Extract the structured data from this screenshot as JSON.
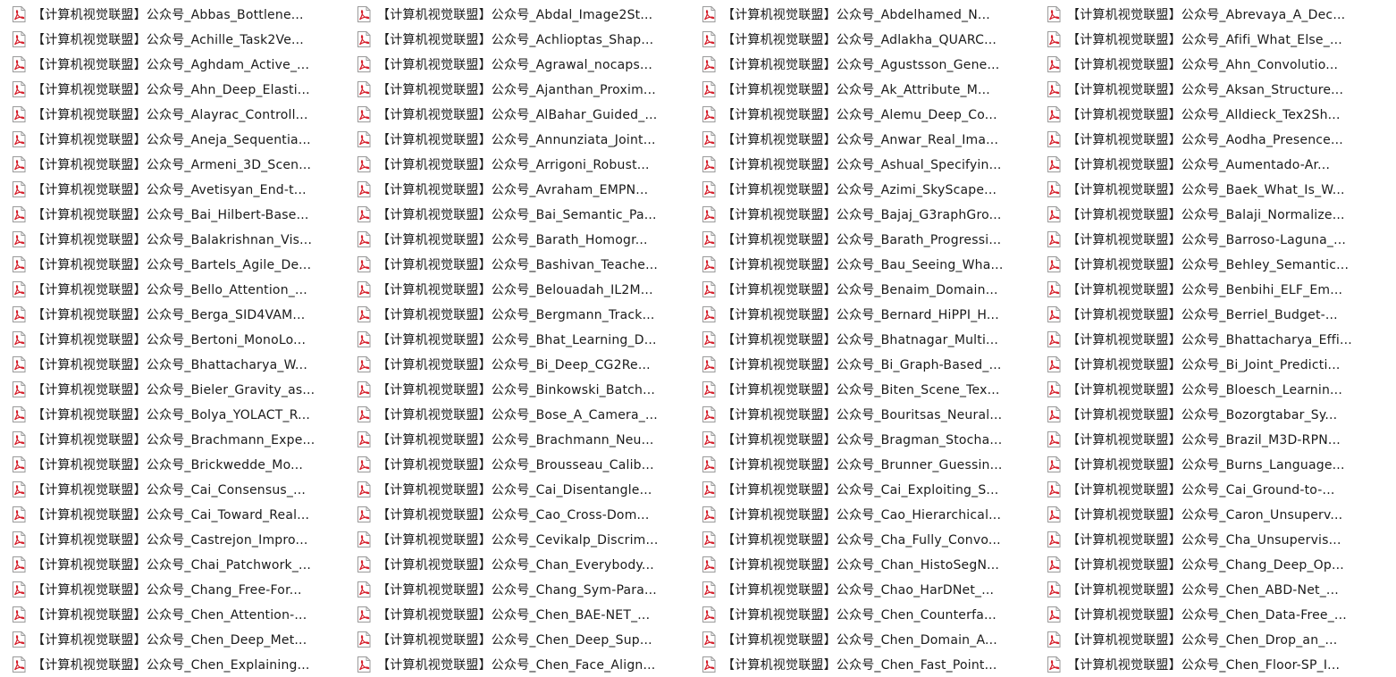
{
  "file_icon": "pdf-icon",
  "accent_color": "#d61e2a",
  "files": [
    [
      "【计算机视觉联盟】公众号_Abbas_Bottlene...",
      "【计算机视觉联盟】公众号_Abdal_Image2St...",
      "【计算机视觉联盟】公众号_Abdelhamed_N...",
      "【计算机视觉联盟】公众号_Abrevaya_A_Dec..."
    ],
    [
      "【计算机视觉联盟】公众号_Achille_Task2Ve...",
      "【计算机视觉联盟】公众号_Achlioptas_Shap...",
      "【计算机视觉联盟】公众号_Adlakha_QUARC...",
      "【计算机视觉联盟】公众号_Afifi_What_Else_..."
    ],
    [
      "【计算机视觉联盟】公众号_Aghdam_Active_...",
      "【计算机视觉联盟】公众号_Agrawal_nocaps...",
      "【计算机视觉联盟】公众号_Agustsson_Gene...",
      "【计算机视觉联盟】公众号_Ahn_Convolutio..."
    ],
    [
      "【计算机视觉联盟】公众号_Ahn_Deep_Elasti...",
      "【计算机视觉联盟】公众号_Ajanthan_Proxim...",
      "【计算机视觉联盟】公众号_Ak_Attribute_M...",
      "【计算机视觉联盟】公众号_Aksan_Structure..."
    ],
    [
      "【计算机视觉联盟】公众号_Alayrac_Controll...",
      "【计算机视觉联盟】公众号_AlBahar_Guided_...",
      "【计算机视觉联盟】公众号_Alemu_Deep_Co...",
      "【计算机视觉联盟】公众号_Alldieck_Tex2Sh..."
    ],
    [
      "【计算机视觉联盟】公众号_Aneja_Sequentia...",
      "【计算机视觉联盟】公众号_Annunziata_Joint...",
      "【计算机视觉联盟】公众号_Anwar_Real_Ima...",
      "【计算机视觉联盟】公众号_Aodha_Presence..."
    ],
    [
      "【计算机视觉联盟】公众号_Armeni_3D_Scen...",
      "【计算机视觉联盟】公众号_Arrigoni_Robust...",
      "【计算机视觉联盟】公众号_Ashual_Specifyin...",
      "【计算机视觉联盟】公众号_Aumentado-Ar..."
    ],
    [
      "【计算机视觉联盟】公众号_Avetisyan_End-t...",
      "【计算机视觉联盟】公众号_Avraham_EMPN...",
      "【计算机视觉联盟】公众号_Azimi_SkyScape...",
      "【计算机视觉联盟】公众号_Baek_What_Is_W..."
    ],
    [
      "【计算机视觉联盟】公众号_Bai_Hilbert-Base...",
      "【计算机视觉联盟】公众号_Bai_Semantic_Pa...",
      "【计算机视觉联盟】公众号_Bajaj_G3raphGro...",
      "【计算机视觉联盟】公众号_Balaji_Normalize..."
    ],
    [
      "【计算机视觉联盟】公众号_Balakrishnan_Vis...",
      "【计算机视觉联盟】公众号_Barath_Homogr...",
      "【计算机视觉联盟】公众号_Barath_Progressi...",
      "【计算机视觉联盟】公众号_Barroso-Laguna_..."
    ],
    [
      "【计算机视觉联盟】公众号_Bartels_Agile_De...",
      "【计算机视觉联盟】公众号_Bashivan_Teache...",
      "【计算机视觉联盟】公众号_Bau_Seeing_Wha...",
      "【计算机视觉联盟】公众号_Behley_Semantic..."
    ],
    [
      "【计算机视觉联盟】公众号_Bello_Attention_...",
      "【计算机视觉联盟】公众号_Belouadah_IL2M...",
      "【计算机视觉联盟】公众号_Benaim_Domain...",
      "【计算机视觉联盟】公众号_Benbihi_ELF_Em..."
    ],
    [
      "【计算机视觉联盟】公众号_Berga_SID4VAM...",
      "【计算机视觉联盟】公众号_Bergmann_Track...",
      "【计算机视觉联盟】公众号_Bernard_HiPPI_H...",
      "【计算机视觉联盟】公众号_Berriel_Budget-..."
    ],
    [
      "【计算机视觉联盟】公众号_Bertoni_MonoLo...",
      "【计算机视觉联盟】公众号_Bhat_Learning_D...",
      "【计算机视觉联盟】公众号_Bhatnagar_Multi...",
      "【计算机视觉联盟】公众号_Bhattacharya_Effi..."
    ],
    [
      "【计算机视觉联盟】公众号_Bhattacharya_W...",
      "【计算机视觉联盟】公众号_Bi_Deep_CG2Re...",
      "【计算机视觉联盟】公众号_Bi_Graph-Based_...",
      "【计算机视觉联盟】公众号_Bi_Joint_Predicti..."
    ],
    [
      "【计算机视觉联盟】公众号_Bieler_Gravity_as...",
      "【计算机视觉联盟】公众号_Binkowski_Batch...",
      "【计算机视觉联盟】公众号_Biten_Scene_Tex...",
      "【计算机视觉联盟】公众号_Bloesch_Learnin..."
    ],
    [
      "【计算机视觉联盟】公众号_Bolya_YOLACT_R...",
      "【计算机视觉联盟】公众号_Bose_A_Camera_...",
      "【计算机视觉联盟】公众号_Bouritsas_Neural...",
      "【计算机视觉联盟】公众号_Bozorgtabar_Sy..."
    ],
    [
      "【计算机视觉联盟】公众号_Brachmann_Expe...",
      "【计算机视觉联盟】公众号_Brachmann_Neu...",
      "【计算机视觉联盟】公众号_Bragman_Stocha...",
      "【计算机视觉联盟】公众号_Brazil_M3D-RPN..."
    ],
    [
      "【计算机视觉联盟】公众号_Brickwedde_Mo...",
      "【计算机视觉联盟】公众号_Brousseau_Calib...",
      "【计算机视觉联盟】公众号_Brunner_Guessin...",
      "【计算机视觉联盟】公众号_Burns_Language..."
    ],
    [
      "【计算机视觉联盟】公众号_Cai_Consensus_...",
      "【计算机视觉联盟】公众号_Cai_Disentangle...",
      "【计算机视觉联盟】公众号_Cai_Exploiting_S...",
      "【计算机视觉联盟】公众号_Cai_Ground-to-..."
    ],
    [
      "【计算机视觉联盟】公众号_Cai_Toward_Real...",
      "【计算机视觉联盟】公众号_Cao_Cross-Dom...",
      "【计算机视觉联盟】公众号_Cao_Hierarchical...",
      "【计算机视觉联盟】公众号_Caron_Unsuperv..."
    ],
    [
      "【计算机视觉联盟】公众号_Castrejon_Impro...",
      "【计算机视觉联盟】公众号_Cevikalp_Discrim...",
      "【计算机视觉联盟】公众号_Cha_Fully_Convo...",
      "【计算机视觉联盟】公众号_Cha_Unsupervis..."
    ],
    [
      "【计算机视觉联盟】公众号_Chai_Patchwork_...",
      "【计算机视觉联盟】公众号_Chan_Everybody...",
      "【计算机视觉联盟】公众号_Chan_HistoSegN...",
      "【计算机视觉联盟】公众号_Chang_Deep_Op..."
    ],
    [
      "【计算机视觉联盟】公众号_Chang_Free-For...",
      "【计算机视觉联盟】公众号_Chang_Sym-Para...",
      "【计算机视觉联盟】公众号_Chao_HarDNet_...",
      "【计算机视觉联盟】公众号_Chen_ABD-Net_..."
    ],
    [
      "【计算机视觉联盟】公众号_Chen_Attention-...",
      "【计算机视觉联盟】公众号_Chen_BAE-NET_...",
      "【计算机视觉联盟】公众号_Chen_Counterfa...",
      "【计算机视觉联盟】公众号_Chen_Data-Free_..."
    ],
    [
      "【计算机视觉联盟】公众号_Chen_Deep_Met...",
      "【计算机视觉联盟】公众号_Chen_Deep_Sup...",
      "【计算机视觉联盟】公众号_Chen_Domain_A...",
      "【计算机视觉联盟】公众号_Chen_Drop_an_..."
    ],
    [
      "【计算机视觉联盟】公众号_Chen_Explaining...",
      "【计算机视觉联盟】公众号_Chen_Face_Align...",
      "【计算机视觉联盟】公众号_Chen_Fast_Point...",
      "【计算机视觉联盟】公众号_Chen_Floor-SP_I..."
    ]
  ]
}
